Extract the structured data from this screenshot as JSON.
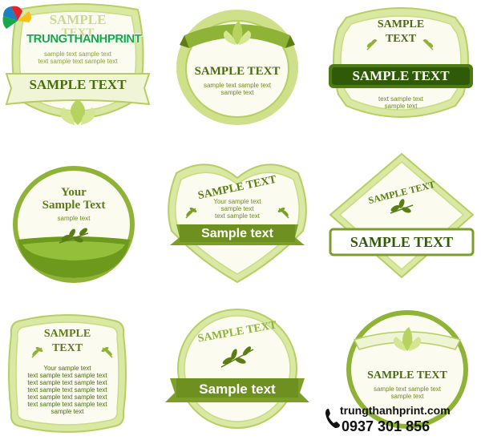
{
  "watermark": {
    "logo_text": "TRUNGTHANHPRINT",
    "website": "trungthanhprint.com",
    "phone": "0937 301 856",
    "colors": {
      "logo_text": "#17a84a",
      "logo_shadow": "#0b4a2a",
      "petal_red": "#e0222b",
      "petal_yellow": "#f6c21a",
      "petal_blue": "#1b7fc4",
      "contact": "#111111"
    }
  },
  "colors": {
    "green_dark": "#5a7d14",
    "green_mid": "#8fb336",
    "green_light": "#cfe08a",
    "green_pale": "#eef4d4",
    "cream": "#fbfbef",
    "text_green": "#4a6b10"
  },
  "labels": [
    {
      "title": "SAMPLE",
      "subtitle": "TEXT",
      "body": [
        "sample text sample text",
        "text sample text sample text"
      ],
      "banner": "SAMPLE TEXT"
    },
    {
      "title": "SAMPLE TEXT",
      "body": [
        "sample text sample text",
        "sample text"
      ]
    },
    {
      "title": "SAMPLE",
      "subtitle": "TEXT",
      "banner": "SAMPLE TEXT",
      "body": [
        "text sample text",
        "sample text"
      ]
    },
    {
      "title": "Your",
      "subtitle": "Sample Text",
      "body": [
        "sample text"
      ]
    },
    {
      "arc": "SAMPLE TEXT",
      "body": [
        "Your sample text",
        "sample text",
        "text sample text"
      ],
      "banner": "Sample text"
    },
    {
      "arc": "SAMPLE TEXT",
      "banner": "SAMPLE TEXT"
    },
    {
      "title": "SAMPLE",
      "subtitle": "TEXT",
      "body": [
        "Your sample text",
        "text sample text sample text",
        "text sample text sample text",
        "text sample text sample text",
        "text sample text sample text",
        "text sample text sample text",
        "sample text"
      ]
    },
    {
      "arc": "SAMPLE TEXT",
      "banner": "Sample text"
    },
    {
      "title": "SAMPLE TEXT",
      "body": [
        "sample text sample text",
        "sample text"
      ]
    }
  ]
}
